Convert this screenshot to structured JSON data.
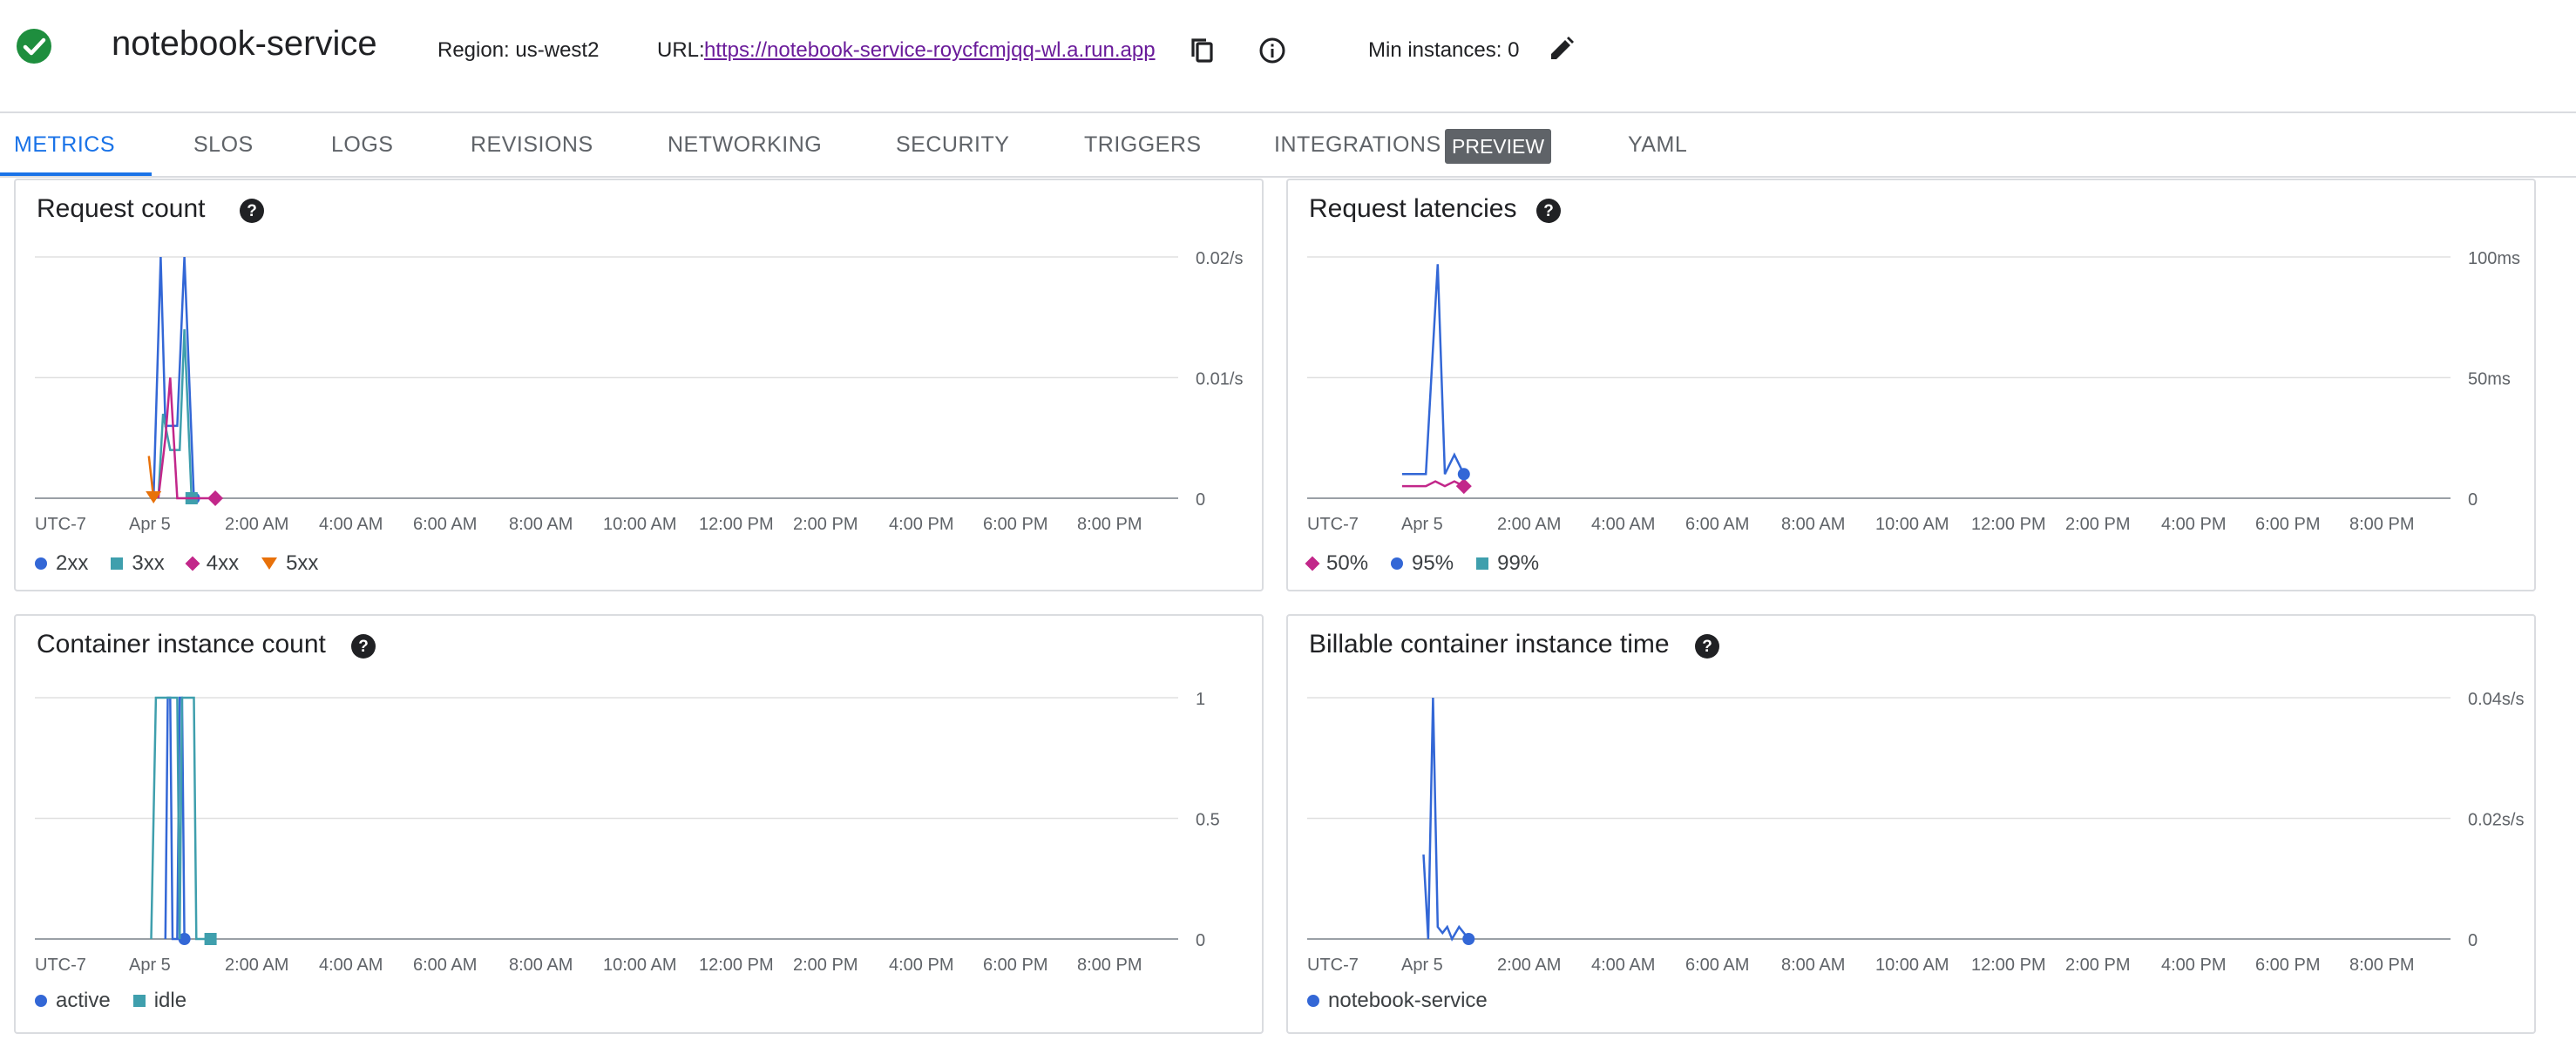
{
  "header": {
    "service_name": "notebook-service",
    "region": "Region: us-west2",
    "url_label": "URL:",
    "url": "https://notebook-service-roycfcmjqq-wl.a.run.app",
    "min_instances": "Min instances: 0",
    "status_color": "#1e8e3e"
  },
  "tabs": [
    {
      "label": "METRICS",
      "active": true
    },
    {
      "label": "SLOS"
    },
    {
      "label": "LOGS"
    },
    {
      "label": "REVISIONS"
    },
    {
      "label": "NETWORKING"
    },
    {
      "label": "SECURITY"
    },
    {
      "label": "TRIGGERS"
    },
    {
      "label": "INTEGRATIONS"
    },
    {
      "label": "YAML"
    }
  ],
  "preview_badge": "PREVIEW",
  "time_axis": [
    "UTC-7",
    "Apr 5",
    "2:00 AM",
    "4:00 AM",
    "6:00 AM",
    "8:00 AM",
    "10:00 AM",
    "12:00 PM",
    "2:00 PM",
    "4:00 PM",
    "6:00 PM",
    "8:00 PM"
  ],
  "chart_data": [
    {
      "type": "line",
      "title": "Request count",
      "y_ticks": [
        "0.02/s",
        "0.01/s",
        "0"
      ],
      "ylim": [
        0,
        0.02
      ],
      "series": [
        {
          "name": "2xx",
          "color": "#3367d6",
          "marker": "circle",
          "points": [
            [
              3.6,
              0
            ],
            [
              3.75,
              0.02
            ],
            [
              3.85,
              0.006
            ],
            [
              4.1,
              0.006
            ],
            [
              4.25,
              0.02
            ],
            [
              4.45,
              0
            ]
          ]
        },
        {
          "name": "3xx",
          "color": "#3f9fad",
          "marker": "square",
          "points": [
            [
              3.7,
              0
            ],
            [
              3.8,
              0.007
            ],
            [
              3.95,
              0.004
            ],
            [
              4.15,
              0.004
            ],
            [
              4.25,
              0.014
            ],
            [
              4.4,
              0
            ]
          ]
        },
        {
          "name": "4xx",
          "color": "#c2278a",
          "marker": "diamond",
          "points": [
            [
              3.7,
              0
            ],
            [
              3.85,
              0.005
            ],
            [
              3.95,
              0.01
            ],
            [
              4.1,
              0
            ],
            [
              4.9,
              0
            ]
          ]
        },
        {
          "name": "5xx",
          "color": "#e8710a",
          "marker": "triangle",
          "points": [
            [
              3.5,
              0.0035
            ],
            [
              3.6,
              0
            ]
          ]
        }
      ]
    },
    {
      "type": "line",
      "title": "Request latencies",
      "y_ticks": [
        "100ms",
        "50ms",
        "0"
      ],
      "ylim": [
        0,
        100
      ],
      "series": [
        {
          "name": "50%",
          "color": "#c2278a",
          "marker": "diamond",
          "points": [
            [
              3.1,
              5
            ],
            [
              3.3,
              5
            ],
            [
              3.6,
              5
            ],
            [
              3.8,
              7
            ],
            [
              4.0,
              5
            ],
            [
              4.2,
              7
            ],
            [
              4.4,
              5
            ]
          ]
        },
        {
          "name": "95%",
          "color": "#3367d6",
          "marker": "circle",
          "points": [
            [
              3.1,
              10
            ],
            [
              3.3,
              10
            ],
            [
              3.6,
              10
            ],
            [
              3.85,
              97
            ],
            [
              4.0,
              10
            ],
            [
              4.2,
              18
            ],
            [
              4.4,
              10
            ]
          ]
        },
        {
          "name": "99%",
          "color": "#3f9fad",
          "marker": "square",
          "points": []
        }
      ]
    },
    {
      "type": "line",
      "title": "Container instance count",
      "y_ticks": [
        "1",
        "0.5",
        "0"
      ],
      "ylim": [
        0,
        1
      ],
      "series": [
        {
          "name": "active",
          "color": "#3367d6",
          "marker": "circle",
          "points": [
            [
              3.85,
              0
            ],
            [
              3.9,
              1
            ],
            [
              3.95,
              1
            ],
            [
              4.0,
              0
            ],
            [
              4.1,
              0
            ],
            [
              4.15,
              1
            ],
            [
              4.2,
              1
            ],
            [
              4.25,
              0
            ]
          ]
        },
        {
          "name": "idle",
          "color": "#3f9fad",
          "marker": "square",
          "points": [
            [
              3.55,
              0
            ],
            [
              3.65,
              1
            ],
            [
              4.1,
              1
            ],
            [
              4.15,
              0
            ],
            [
              4.2,
              1
            ],
            [
              4.45,
              1
            ],
            [
              4.5,
              0
            ],
            [
              4.8,
              0
            ]
          ]
        }
      ]
    },
    {
      "type": "line",
      "title": "Billable container instance time",
      "y_ticks": [
        "0.04s/s",
        "0.02s/s",
        "0"
      ],
      "ylim": [
        0,
        0.04
      ],
      "series": [
        {
          "name": "notebook-service",
          "color": "#3367d6",
          "marker": "circle",
          "points": [
            [
              3.55,
              0.014
            ],
            [
              3.65,
              0
            ],
            [
              3.75,
              0.04
            ],
            [
              3.85,
              0.002
            ],
            [
              3.95,
              0.001
            ],
            [
              4.05,
              0.002
            ],
            [
              4.15,
              0
            ],
            [
              4.3,
              0.002
            ],
            [
              4.5,
              0
            ]
          ]
        }
      ]
    }
  ]
}
